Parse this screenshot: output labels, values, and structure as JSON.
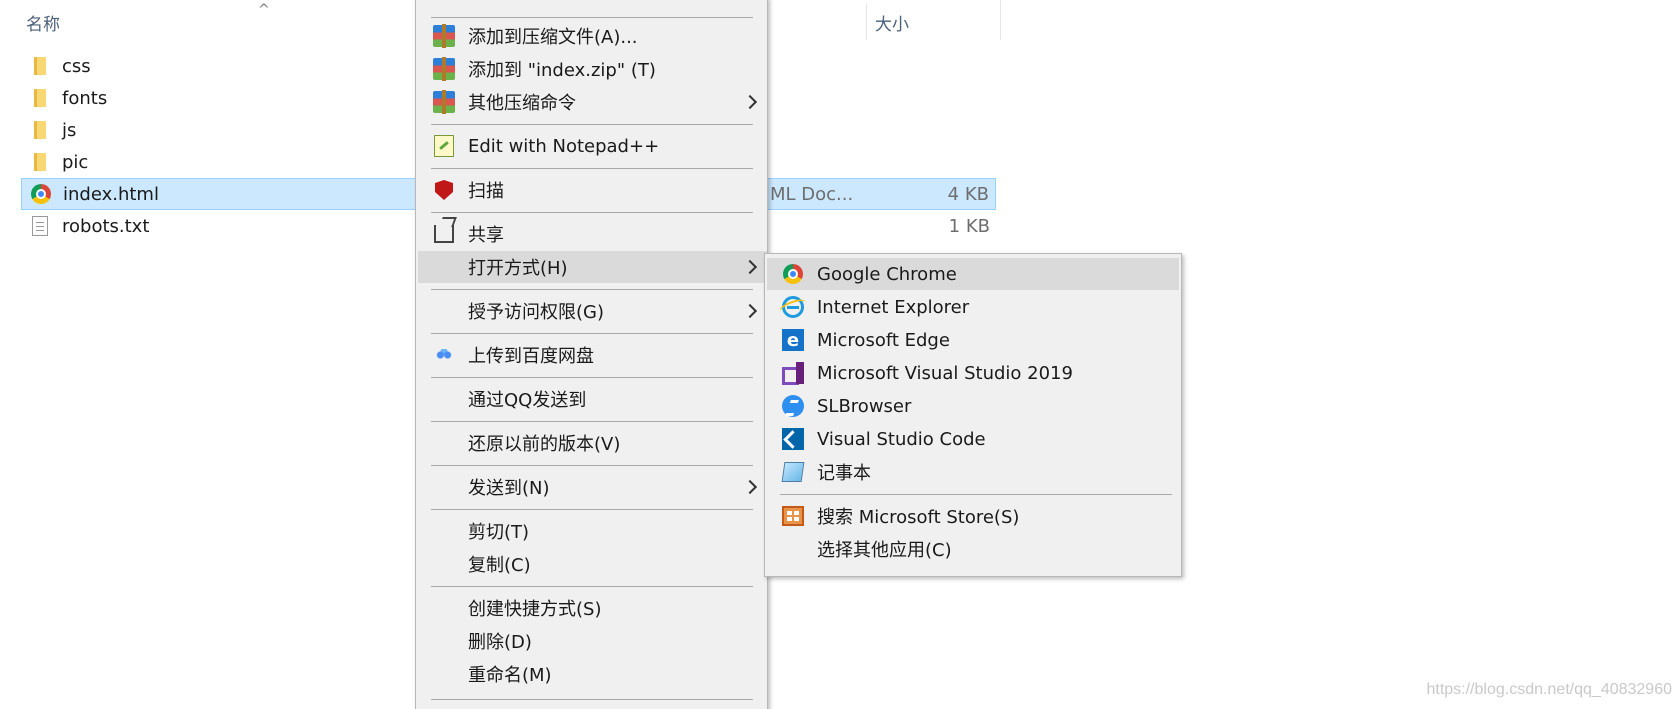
{
  "header": {
    "name_col": "名称",
    "size_col": "大小"
  },
  "files": [
    {
      "name": "css",
      "icon": "folder-icon",
      "type": "",
      "size": ""
    },
    {
      "name": "fonts",
      "icon": "folder-icon",
      "type": "",
      "size": ""
    },
    {
      "name": "js",
      "icon": "folder-icon",
      "type": "",
      "size": ""
    },
    {
      "name": "pic",
      "icon": "folder-icon",
      "type": "",
      "size": ""
    },
    {
      "name": "index.html",
      "icon": "chrome-icon",
      "type": "ML Doc...",
      "size": "4 KB",
      "selected": true
    },
    {
      "name": "robots.txt",
      "icon": "text-file-icon",
      "type": "",
      "size": "1 KB"
    }
  ],
  "context_menu": {
    "items": [
      {
        "label": "添加到压缩文件(A)...",
        "icon": "winrar-icon"
      },
      {
        "label": "添加到 \"index.zip\" (T)",
        "icon": "winrar-icon"
      },
      {
        "label": "其他压缩命令",
        "icon": "winrar-icon",
        "submenu": true
      },
      {
        "label": "Edit with Notepad++",
        "icon": "notepad-plus-plus-icon"
      },
      {
        "label": "扫描",
        "icon": "mcafee-icon"
      },
      {
        "label": "共享",
        "icon": "share-icon"
      },
      {
        "label": "打开方式(H)",
        "icon": "",
        "submenu": true,
        "highlighted": true
      },
      {
        "label": "授予访问权限(G)",
        "icon": "",
        "submenu": true
      },
      {
        "label": "上传到百度网盘",
        "icon": "baidu-netdisk-icon"
      },
      {
        "label": "通过QQ发送到",
        "icon": ""
      },
      {
        "label": "还原以前的版本(V)",
        "icon": ""
      },
      {
        "label": "发送到(N)",
        "icon": "",
        "submenu": true
      },
      {
        "label": "剪切(T)",
        "icon": ""
      },
      {
        "label": "复制(C)",
        "icon": ""
      },
      {
        "label": "创建快捷方式(S)",
        "icon": ""
      },
      {
        "label": "删除(D)",
        "icon": ""
      },
      {
        "label": "重命名(M)",
        "icon": ""
      }
    ]
  },
  "open_with_menu": {
    "items": [
      {
        "label": "Google Chrome",
        "icon": "chrome-icon",
        "highlighted": true
      },
      {
        "label": "Internet Explorer",
        "icon": "internet-explorer-icon"
      },
      {
        "label": "Microsoft Edge",
        "icon": "edge-icon"
      },
      {
        "label": "Microsoft Visual Studio 2019",
        "icon": "visual-studio-icon"
      },
      {
        "label": "SLBrowser",
        "icon": "slbrowser-icon"
      },
      {
        "label": "Visual Studio Code",
        "icon": "vscode-icon"
      },
      {
        "label": "记事本",
        "icon": "notepad-icon"
      },
      {
        "label": "搜索 Microsoft Store(S)",
        "icon": "microsoft-store-icon"
      },
      {
        "label": "选择其他应用(C)",
        "icon": ""
      }
    ]
  },
  "watermark": "https://blog.csdn.net/qq_40832960",
  "colors": {
    "selection_bg": "#cce8ff",
    "selection_border": "#99d1ff",
    "menu_bg": "#f0f0f0",
    "menu_hover": "#dadada",
    "header_text": "#4c607a"
  }
}
